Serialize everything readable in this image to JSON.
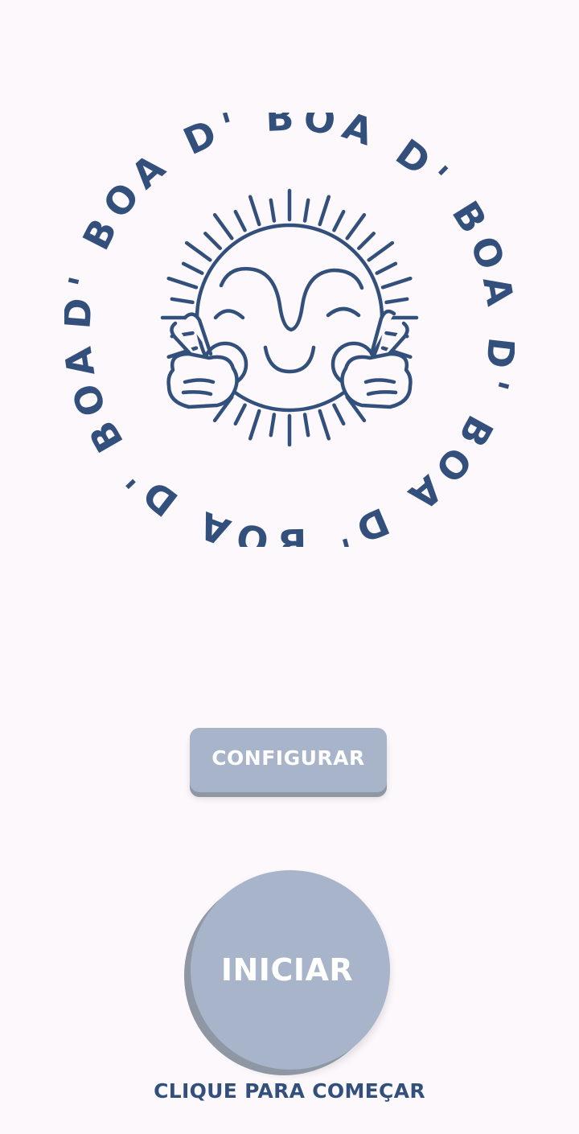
{
  "logo": {
    "ring_text": "D' BOA D' BOA D' BOA D' BOA D' BOA D' BOA",
    "color": "#33507d",
    "icon": "sun-mascot-peace-sign-icon"
  },
  "buttons": {
    "configure_label": "CONFIGURAR",
    "start_label": "INICIAR"
  },
  "hint": "CLIQUE PARA COMEÇAR",
  "colors": {
    "background": "#fcf8fb",
    "button": "#a7b4ca",
    "button_shadow": "#8f96a4",
    "brand": "#33507d"
  }
}
